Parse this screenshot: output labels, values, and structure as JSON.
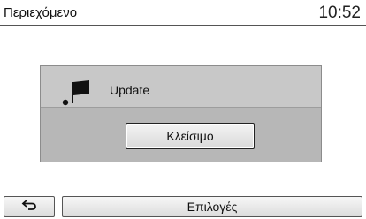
{
  "header": {
    "title": "Περιεχόμενο",
    "time": "10:52"
  },
  "dialog": {
    "icon": "flag-icon",
    "label": "Update",
    "close_button": "Κλείσιμο"
  },
  "footer": {
    "back_icon": "back-arrow-icon",
    "options_label": "Επιλογές"
  }
}
